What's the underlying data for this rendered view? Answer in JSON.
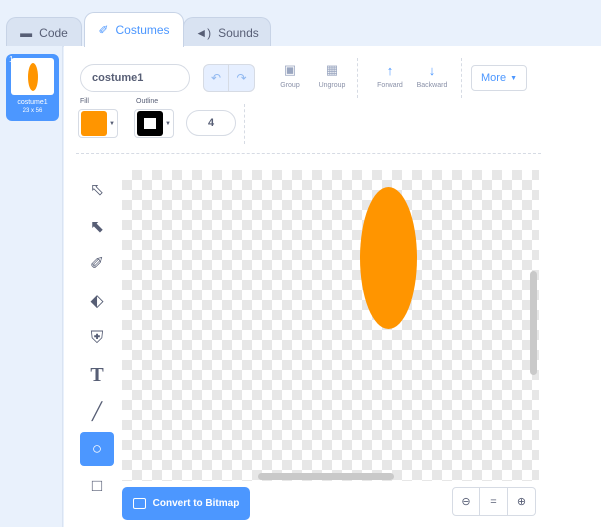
{
  "tabs": [
    {
      "label": "Code",
      "icon": "code-blocks-icon"
    },
    {
      "label": "Costumes",
      "icon": "brush-icon"
    },
    {
      "label": "Sounds",
      "icon": "speaker-icon"
    }
  ],
  "active_tab": "Costumes",
  "costume_list": {
    "items": [
      {
        "number": "1",
        "name": "costume1",
        "size": "23 x 56",
        "selected": true,
        "thumbnail_color": "#ff9500"
      }
    ]
  },
  "editor": {
    "costume_name": "costume1",
    "toolbar": {
      "group_label": "Group",
      "ungroup_label": "Ungroup",
      "forward_label": "Forward",
      "backward_label": "Backward",
      "more_label": "More"
    },
    "fill_label": "Fill",
    "outline_label": "Outline",
    "fill_color": "#ff9500",
    "outline_color": "#000000",
    "outline_width": "4",
    "tools": [
      {
        "name": "select",
        "icon": "arrow-icon"
      },
      {
        "name": "reshape",
        "icon": "reshape-icon"
      },
      {
        "name": "brush",
        "icon": "brush-icon"
      },
      {
        "name": "eraser",
        "icon": "eraser-icon"
      },
      {
        "name": "fill",
        "icon": "fill-bucket-icon"
      },
      {
        "name": "text",
        "icon": "text-icon",
        "glyph": "T"
      },
      {
        "name": "line",
        "icon": "line-icon"
      },
      {
        "name": "circle",
        "icon": "circle-icon",
        "active": true
      },
      {
        "name": "rectangle",
        "icon": "rectangle-icon"
      }
    ],
    "canvas_shape_color": "#ff9500",
    "convert_label": "Convert to Bitmap",
    "zoom_reset_label": "="
  },
  "colors": {
    "accent": "#4c97ff",
    "costume_orange": "#ff9500"
  }
}
